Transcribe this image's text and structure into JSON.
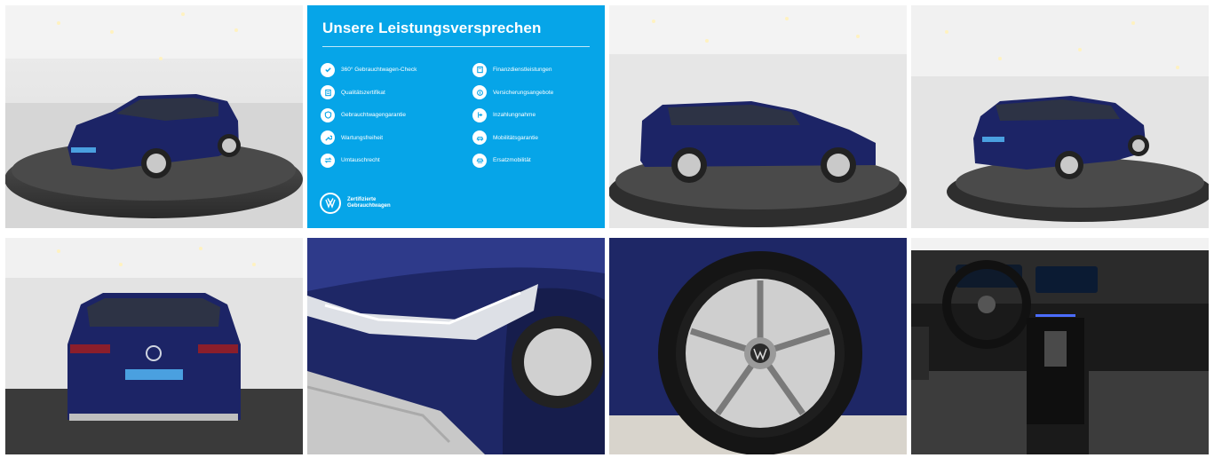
{
  "gallery": {
    "photos": [
      {
        "id": "front-left-3q",
        "alt": "VW Golf Variant front left three-quarter view in showroom"
      },
      {
        "id": "promise-panel"
      },
      {
        "id": "side-profile",
        "alt": "VW Golf Variant side profile"
      },
      {
        "id": "rear-right-3q",
        "alt": "VW Golf Variant rear right three-quarter view"
      },
      {
        "id": "rear",
        "alt": "VW Golf Variant rear view"
      },
      {
        "id": "headlight",
        "alt": "Headlight detail"
      },
      {
        "id": "wheel",
        "alt": "Alloy wheel detail"
      },
      {
        "id": "interior",
        "alt": "Cockpit interior"
      }
    ]
  },
  "promise": {
    "title": "Unsere Leistungsversprechen",
    "left_items": [
      {
        "label": "360° Gebrauchtwagen-Check",
        "icon": "check-badge-icon"
      },
      {
        "label": "Qualitätszertifikat",
        "icon": "certificate-icon"
      },
      {
        "label": "Gebrauchtwagengarantie",
        "icon": "shield-icon"
      },
      {
        "label": "Wartungsfreiheit",
        "icon": "wrench-icon"
      },
      {
        "label": "Umtauschrecht",
        "icon": "exchange-icon"
      }
    ],
    "right_items": [
      {
        "label": "Finanzdienstleistungen",
        "icon": "finance-icon"
      },
      {
        "label": "Versicherungsangebote",
        "icon": "insurance-icon"
      },
      {
        "label": "Inzahlungnahme",
        "icon": "trade-in-icon"
      },
      {
        "label": "Mobilitätsgarantie",
        "icon": "mobility-icon"
      },
      {
        "label": "Ersatzmobilität",
        "icon": "replacement-car-icon"
      }
    ],
    "brand_line1": "Zertifizierte",
    "brand_line2": "Gebrauchtwagen"
  },
  "colors": {
    "panel_blue": "#06a5e8",
    "car_blue": "#1c2466"
  }
}
